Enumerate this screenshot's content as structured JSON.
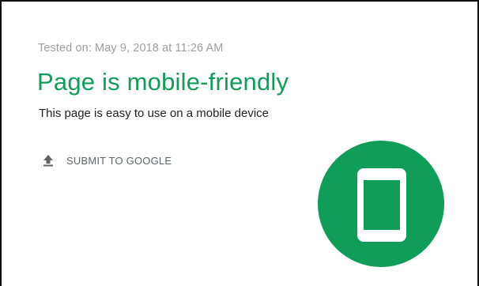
{
  "result": {
    "tested_on": "Tested on: May 9, 2018 at 11:26 AM",
    "title": "Page is mobile-friendly",
    "subtitle": "This page is easy to use on a mobile device"
  },
  "actions": {
    "submit_label": "SUBMIT TO GOOGLE",
    "submit_icon": "upload-icon"
  },
  "badge": {
    "icon": "mobile-phone-icon"
  },
  "colors": {
    "accent_green": "#0f9d58",
    "text_primary": "#212121",
    "text_muted": "#9e9e9e",
    "icon_gray": "#5f6368"
  }
}
